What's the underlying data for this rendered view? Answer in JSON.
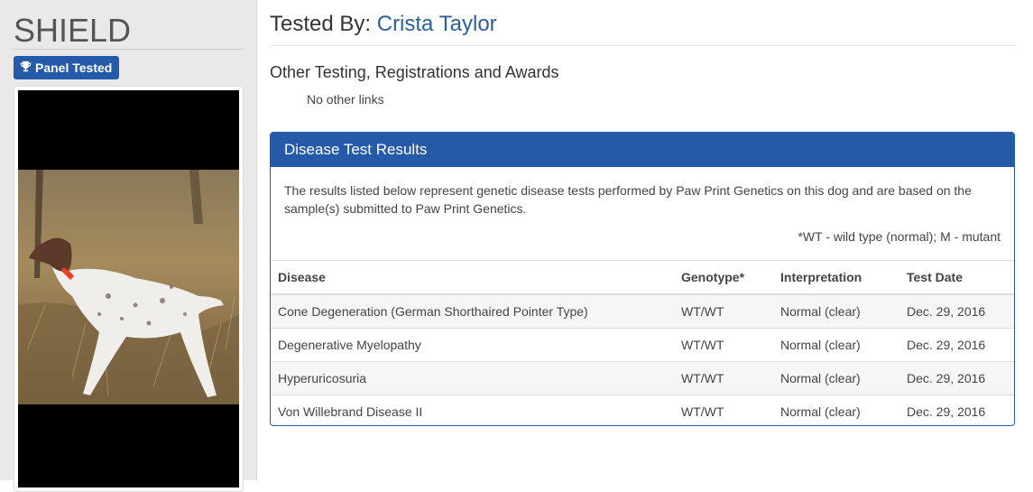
{
  "sidebar": {
    "dog_name": "SHIELD",
    "badge_label": "Panel Tested",
    "badge_icon": "trophy-icon",
    "photo_alt": "dog photo"
  },
  "main": {
    "tested_by_prefix": "Tested By:",
    "tested_by_name": "Crista Taylor",
    "other_heading": "Other Testing, Registrations and Awards",
    "no_links": "No other links"
  },
  "panel": {
    "title": "Disease Test Results",
    "description": "The results listed below represent genetic disease tests performed by Paw Print Genetics on this dog and are based on the sample(s) submitted to Paw Print Genetics.",
    "legend": "*WT - wild type (normal); M - mutant",
    "headers": [
      "Disease",
      "Genotype*",
      "Interpretation",
      "Test Date"
    ],
    "rows": [
      [
        "Cone Degeneration (German Shorthaired Pointer Type)",
        "WT/WT",
        "Normal (clear)",
        "Dec. 29, 2016"
      ],
      [
        "Degenerative Myelopathy",
        "WT/WT",
        "Normal (clear)",
        "Dec. 29, 2016"
      ],
      [
        "Hyperuricosuria",
        "WT/WT",
        "Normal (clear)",
        "Dec. 29, 2016"
      ],
      [
        "Von Willebrand Disease II",
        "WT/WT",
        "Normal (clear)",
        "Dec. 29, 2016"
      ]
    ]
  },
  "colors": {
    "brand_blue": "#245aa8",
    "link_blue": "#2c5e9e",
    "sidebar_bg": "#e9e9e9"
  }
}
